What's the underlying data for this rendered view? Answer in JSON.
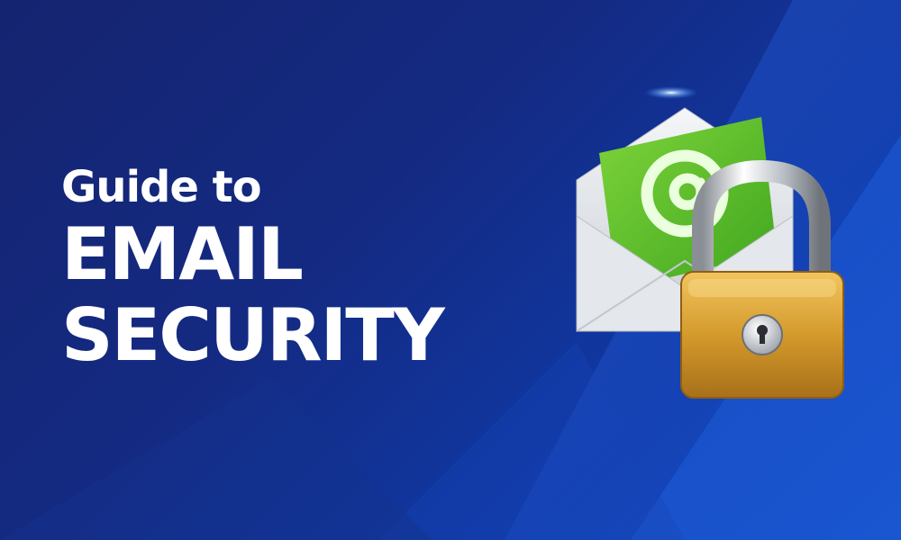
{
  "title": {
    "line1": "Guide to",
    "line2": "EMAIL",
    "line3": "SECURITY"
  },
  "illustration": {
    "envelope_symbol": "@",
    "icons": [
      "envelope-icon",
      "at-sign-icon",
      "padlock-icon",
      "keyhole-icon"
    ]
  },
  "colors": {
    "background_dark": "#152470",
    "background_light": "#1550c8",
    "text": "#ffffff",
    "letter_green": "#5cc22c",
    "padlock_gold": "#d49a2c"
  }
}
